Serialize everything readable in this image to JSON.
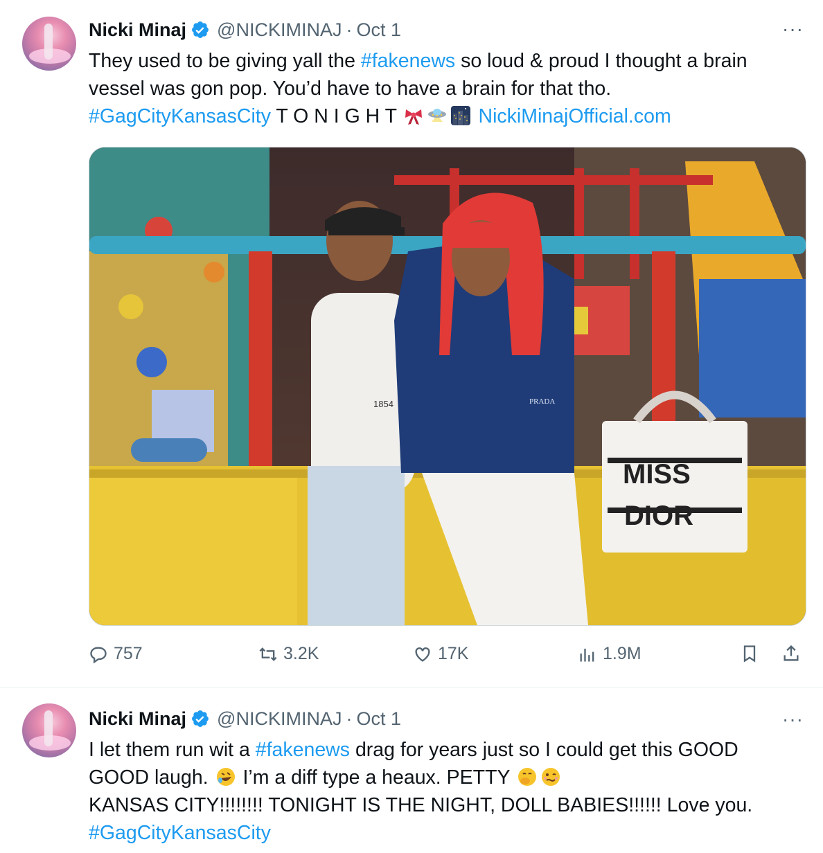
{
  "tweets": [
    {
      "name": "Nicki Minaj",
      "handle": "@NICKIMINAJ",
      "separator": "·",
      "date": "Oct 1",
      "more": "···",
      "text": {
        "line1_a": "They used to be giving yall the ",
        "line1_link": "#fakenews",
        "line1_b": " so loud & proud I thought a brain",
        "line2": "vessel was gon pop. You’d have to have a brain for that tho.",
        "line3_link": "#GagCityKansasCity",
        "line3_b": " T O N I G H T ",
        "line3_url": "NickiMinajOfficial.com"
      },
      "image_text": {
        "bag_line1": "MISS",
        "bag_line2": "DIOR",
        "shirt": "1854",
        "jacket": "PRADA"
      },
      "stats": {
        "replies": "757",
        "reposts": "3.2K",
        "likes": "17K",
        "views": "1.9M"
      }
    },
    {
      "name": "Nicki Minaj",
      "handle": "@NICKIMINAJ",
      "separator": "·",
      "date": "Oct 1",
      "more": "···",
      "text": {
        "line1_a": "I let them run wit a ",
        "line1_link": "#fakenews",
        "line1_b": " drag for years just so I could get this GOOD",
        "line2_a": "GOOD laugh. ",
        "line2_b": " I’m a diff type a heaux. PETTY ",
        "line3": "KANSAS CITY!!!!!!!! TONIGHT IS THE NIGHT, DOLL BABIES!!!!!! Love you.",
        "line4_link": "#GagCityKansasCity"
      }
    }
  ],
  "colors": {
    "link": "#1d9bf0",
    "secondary": "#536471",
    "text": "#0f1419",
    "verified": "#1d9bf0"
  },
  "icons": [
    "verified-badge-icon",
    "ribbon-emoji",
    "ufo-emoji",
    "city-night-emoji",
    "reply-icon",
    "repost-icon",
    "like-icon",
    "views-icon",
    "bookmark-icon",
    "share-icon",
    "rofl-emoji",
    "yawn-emoji",
    "woozy-emoji"
  ]
}
